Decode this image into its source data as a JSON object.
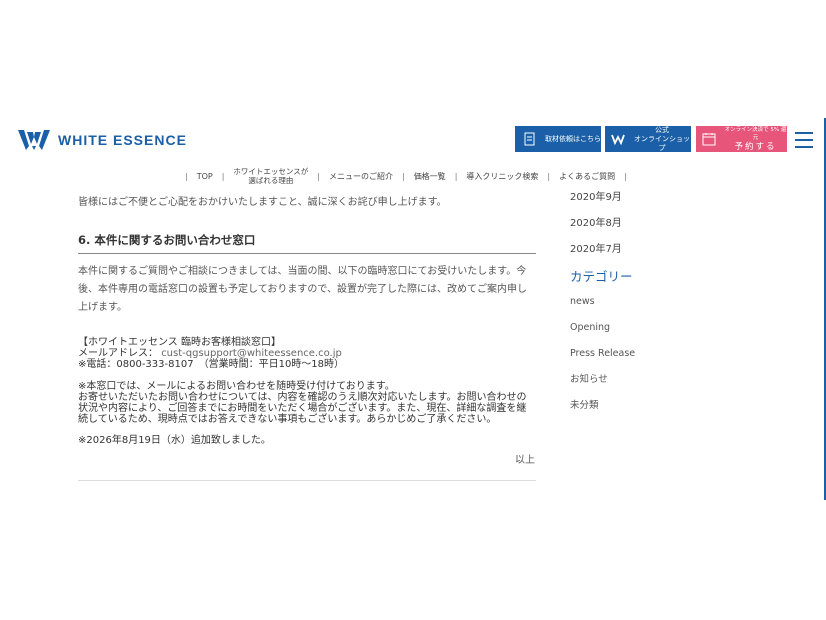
{
  "header": {
    "logo_text": "WHITE ESSENCE",
    "btn_shuzai": "取材依頼はこちら",
    "btn_online_line1": "公式",
    "btn_online_line2": "オンラインショップ",
    "btn_reserve_small": "オンライン決済で 5% 還元",
    "btn_reserve_big": "予約する",
    "brand_color": "#1b5fa8",
    "reserve_color": "#e8557a"
  },
  "nav": {
    "items": [
      "TOP",
      "ホワイトエッセンスが",
      "選ばれる理由",
      "メニューのご紹介",
      "価格一覧",
      "導入クリニック検索",
      "よくあるご質問"
    ]
  },
  "article": {
    "intro": "皆様にはご不便とご心配をおかけいたしますこと、誠に深くお詫び申し上げます。",
    "heading": "6. 本件に関するお問い合わせ窓口",
    "body": "本件に関するご質問やご相談につきましては、当面の間、以下の臨時窓口にてお受けいたします。今後、本件専用の電話窓口の設置も予定しておりますので、設置が完了した際には、改めてご案内申し上げます。",
    "contact_title": "【ホワイトエッセンス 臨時お客様相談窓口】",
    "mail_label": "メールアドレス：",
    "mail_value": "cust-qgsupport@whiteessence.co.jp",
    "phone": "※電話：0800-333-8107　（営業時間：平日10時～18時）",
    "note1": "※本窓口では、メールによるお問い合わせを随時受け付けております。",
    "note2": "お寄せいただいたお問い合わせについては、内容を確認のうえ順次対応いたします。お問い合わせの状況や内容により、ご回答までにお時間をいただく場合がございます。また、現在、詳細な調査を継続しているため、現時点ではお答えできない事項もございます。あらかじめご了承ください。",
    "added": "※2026年8月19日（水）追加致しました。",
    "end": "以上"
  },
  "sidebar": {
    "months": [
      "2020年9月",
      "2020年8月",
      "2020年7月"
    ],
    "category_title": "カテゴリー",
    "categories": [
      "news",
      "Opening",
      "Press Release",
      "お知らせ",
      "未分類"
    ]
  }
}
